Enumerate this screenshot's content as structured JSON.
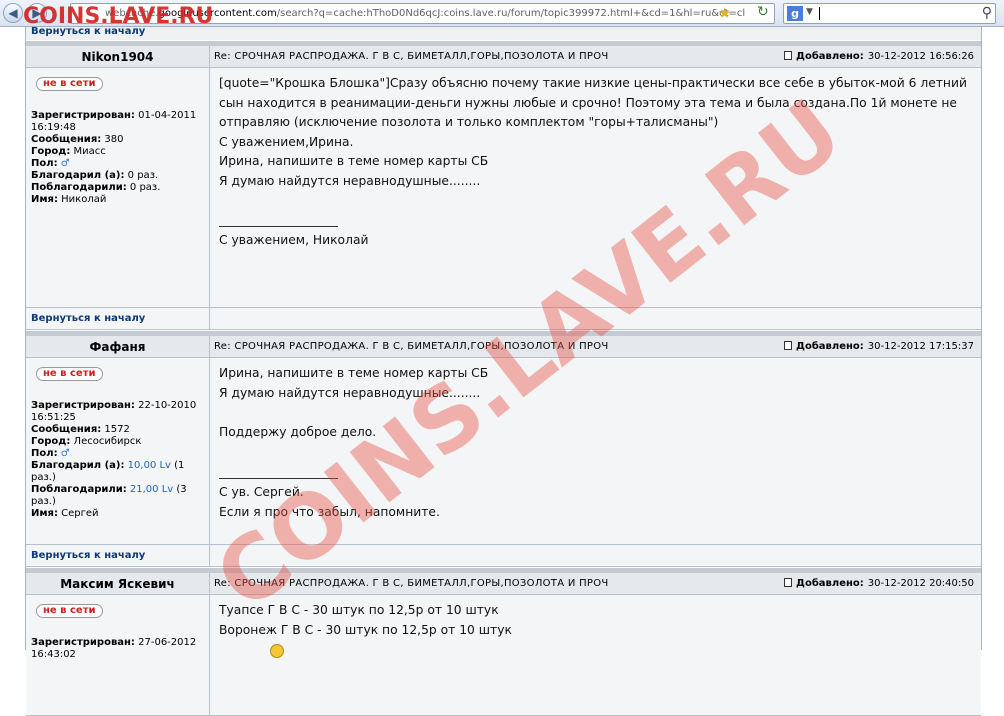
{
  "browser": {
    "url_prefix": "webcache.",
    "url_domain": "googleusercontent.com",
    "url_rest": "/search?q=cache:hThoD0Nd6qcJ:coins.lave.ru/forum/topic399972.html+&cd=1&hl=ru&ct=cl",
    "search_engine_letter": "g",
    "site_logo": "COINS.LAVE.RU"
  },
  "forum": {
    "top_back_label": "Вернуться к началу",
    "posts": [
      {
        "author": "Nikon1904",
        "title_prefix": "Re:",
        "title": "СРОЧНАЯ РАСПРОДАЖА. Г В С, БИМЕТАЛЛ,ГОРЫ,ПОЗОЛОТА И ПРОЧ",
        "date_label": "Добавлено:",
        "date": "30-12-2012 16:56:26",
        "status": "не в сети",
        "registered_label": "Зарегистрирован:",
        "registered": "01-04-2011",
        "registered_time": "16:19:48",
        "messages_label": "Сообщения:",
        "messages": "380",
        "city_label": "Город:",
        "city": "Миасс",
        "sex_label": "Пол:",
        "sex": "♂",
        "thanked_label": "Благодарил (а):",
        "thanked": "0 раз.",
        "thanked_by_label": "Поблагодарили:",
        "thanked_by": "0 раз.",
        "name_label": "Имя:",
        "name": "Николай",
        "body": [
          "[quote=\"Крошка Блошка\"]Сразу объясню почему такие низкие цены-практически все себе в убыток-мой 6 летний",
          "сын находится в реанимации-деньги нужны любые и срочно! Поэтому эта тема и была создана.По 1й монете не",
          "отправляю (исключение позолота и только комплектом \"горы+талисманы\")",
          "С уважением,Ирина.",
          "Ирина, напишите в теме номер карты СБ",
          "Я думаю найдутся неравнодушные........"
        ],
        "signature": "С уважением, Николай",
        "back_label": "Вернуться к началу"
      },
      {
        "author": "Фафаня",
        "title_prefix": "Re:",
        "title": "СРОЧНАЯ РАСПРОДАЖА. Г В С, БИМЕТАЛЛ,ГОРЫ,ПОЗОЛОТА И ПРОЧ",
        "date_label": "Добавлено:",
        "date": "30-12-2012 17:15:37",
        "status": "не в сети",
        "registered_label": "Зарегистрирован:",
        "registered": "22-10-2010",
        "registered_time": "16:51:25",
        "messages_label": "Сообщения:",
        "messages": "1572",
        "city_label": "Город:",
        "city": "Лесосибирск",
        "sex_label": "Пол:",
        "sex": "♂",
        "thanked_label": "Благодарил (а):",
        "thanked": "10,00 Lv",
        "thanked_extra": "(1",
        "thanked_extra2": "раз.)",
        "thanked_by_label": "Поблагодарили:",
        "thanked_by": "21,00 Lv",
        "thanked_by_extra": "(3",
        "thanked_by_extra2": "раз.)",
        "name_label": "Имя:",
        "name": "Сергей",
        "body": [
          "Ирина, напишите в теме номер карты СБ",
          "Я думаю найдутся неравнодушные........",
          "",
          "Поддержу доброе дело."
        ],
        "signature": "С ув. Сергей.",
        "signature2": "Если я про что забыл, напомните.",
        "back_label": "Вернуться к началу"
      },
      {
        "author": "Максим Яскевич",
        "title_prefix": "Re:",
        "title": "СРОЧНАЯ РАСПРОДАЖА. Г В С, БИМЕТАЛЛ,ГОРЫ,ПОЗОЛОТА И ПРОЧ",
        "date_label": "Добавлено:",
        "date": "30-12-2012 20:40:50",
        "status": "не в сети",
        "registered_label": "Зарегистрирован:",
        "registered": "27-06-2012",
        "registered_time": "16:43:02",
        "body": [
          "Туапсе Г В С - 30 штук по 12,5р от 10 штук",
          "Воронеж Г В С - 30 штук по 12,5р от 10 штук"
        ]
      }
    ]
  },
  "watermark": "COINS.LAVE.RU"
}
